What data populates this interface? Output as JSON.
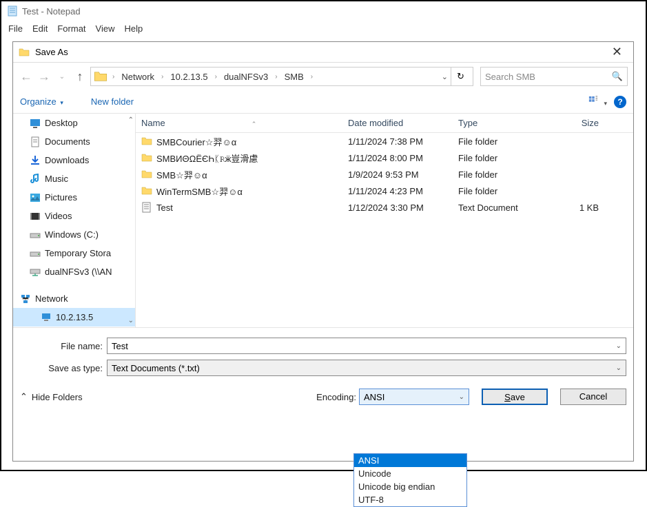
{
  "notepad": {
    "title": "Test - Notepad",
    "menus": [
      "File",
      "Edit",
      "Format",
      "View",
      "Help"
    ]
  },
  "dialog": {
    "title": "Save As",
    "breadcrumbs": [
      "Network",
      "10.2.13.5",
      "dualNFSv3",
      "SMB"
    ],
    "search_placeholder": "Search SMB",
    "toolbar": {
      "organize": "Organize",
      "newfolder": "New folder"
    },
    "nav": [
      {
        "label": "Desktop",
        "icon": "desktop"
      },
      {
        "label": "Documents",
        "icon": "documents"
      },
      {
        "label": "Downloads",
        "icon": "downloads"
      },
      {
        "label": "Music",
        "icon": "music"
      },
      {
        "label": "Pictures",
        "icon": "pictures"
      },
      {
        "label": "Videos",
        "icon": "videos"
      },
      {
        "label": "Windows (C:)",
        "icon": "drive"
      },
      {
        "label": "Temporary Stora",
        "icon": "drive"
      },
      {
        "label": "dualNFSv3 (\\\\AN",
        "icon": "netdrive"
      }
    ],
    "nav2": [
      {
        "label": "Network",
        "icon": "network"
      },
      {
        "label": "10.2.13.5",
        "icon": "computer",
        "selected": true
      }
    ],
    "columns": {
      "name": "Name",
      "date": "Date modified",
      "type": "Type",
      "size": "Size"
    },
    "rows": [
      {
        "name": "SMBCourier☆羿☺α",
        "date": "1/11/2024 7:38 PM",
        "type": "File folder",
        "size": "",
        "icon": "folder"
      },
      {
        "name": "SMBИΘΩЁЄҺᛕℝӝ豈滑慮",
        "date": "1/11/2024 8:00 PM",
        "type": "File folder",
        "size": "",
        "icon": "folder"
      },
      {
        "name": "SMB☆羿☺α",
        "date": "1/9/2024 9:53 PM",
        "type": "File folder",
        "size": "",
        "icon": "folder"
      },
      {
        "name": "WinTermSMB☆羿☺α",
        "date": "1/11/2024 4:23 PM",
        "type": "File folder",
        "size": "",
        "icon": "folder"
      },
      {
        "name": "Test",
        "date": "1/12/2024 3:30 PM",
        "type": "Text Document",
        "size": "1 KB",
        "icon": "txt"
      }
    ],
    "filename_label": "File name:",
    "filename_value": "Test",
    "saveastype_label": "Save as type:",
    "saveastype_value": "Text Documents (*.txt)",
    "hide_folders": "Hide Folders",
    "encoding_label": "Encoding:",
    "encoding_value": "ANSI",
    "encoding_options": [
      "ANSI",
      "Unicode",
      "Unicode big endian",
      "UTF-8"
    ],
    "save": "Save",
    "cancel": "Cancel"
  }
}
